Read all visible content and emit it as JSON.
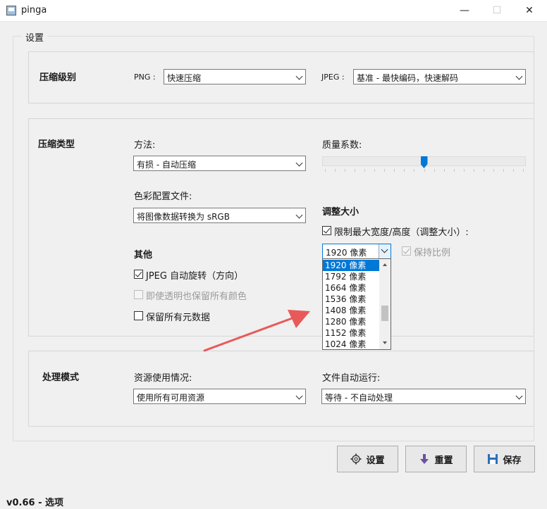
{
  "window": {
    "title": "pinga",
    "minimize": "—",
    "maximize": "☐",
    "close": "✕"
  },
  "settings_group": {
    "title": "设置"
  },
  "compression_level": {
    "heading": "压缩级别",
    "png_label": "PNG :",
    "png_value": "快速压缩",
    "jpeg_label": "JPEG :",
    "jpeg_value": "基准 - 最快编码，快速解码"
  },
  "compression_type": {
    "heading": "压缩类型",
    "method_label": "方法:",
    "method_value": "有损 - 自动压缩",
    "color_profile_label": "色彩配置文件:",
    "color_profile_value": "将图像数据转换为 sRGB",
    "quality_label": "质量系数:",
    "quality_level_percent": 50
  },
  "resize": {
    "heading": "调整大小",
    "limit_label": "限制最大宽度/高度（调整大小）:",
    "limit_checked": true,
    "size_value": "1920 像素",
    "keep_ratio_label": "保持比例",
    "keep_ratio_checked": true,
    "keep_ratio_enabled": false,
    "size_options": [
      "1920 像素",
      "1792 像素",
      "1664 像素",
      "1536 像素",
      "1408 像素",
      "1280 像素",
      "1152 像素",
      "1024 像素"
    ],
    "selected_index": 0
  },
  "other": {
    "heading": "其他",
    "jpeg_rotate_label": "JPEG 自动旋转（方向）",
    "jpeg_rotate_checked": true,
    "keep_colors_label": "即使透明也保留所有颜色",
    "keep_colors_enabled": false,
    "keep_metadata_label": "保留所有元数据",
    "keep_metadata_checked": false
  },
  "processing_mode": {
    "heading": "处理模式",
    "resource_label": "资源使用情况:",
    "resource_value": "使用所有可用资源",
    "auto_run_label": "文件自动运行:",
    "auto_run_value": "等待 - 不自动处理"
  },
  "buttons": {
    "settings": "设置",
    "reset": "重置",
    "save": "保存"
  },
  "status_text": "v0.66 - 选项",
  "colors": {
    "accent": "#0078d7",
    "arrow": "#e85a5a"
  },
  "icons": [
    "gear-icon",
    "down-arrow-icon",
    "save-icon"
  ]
}
